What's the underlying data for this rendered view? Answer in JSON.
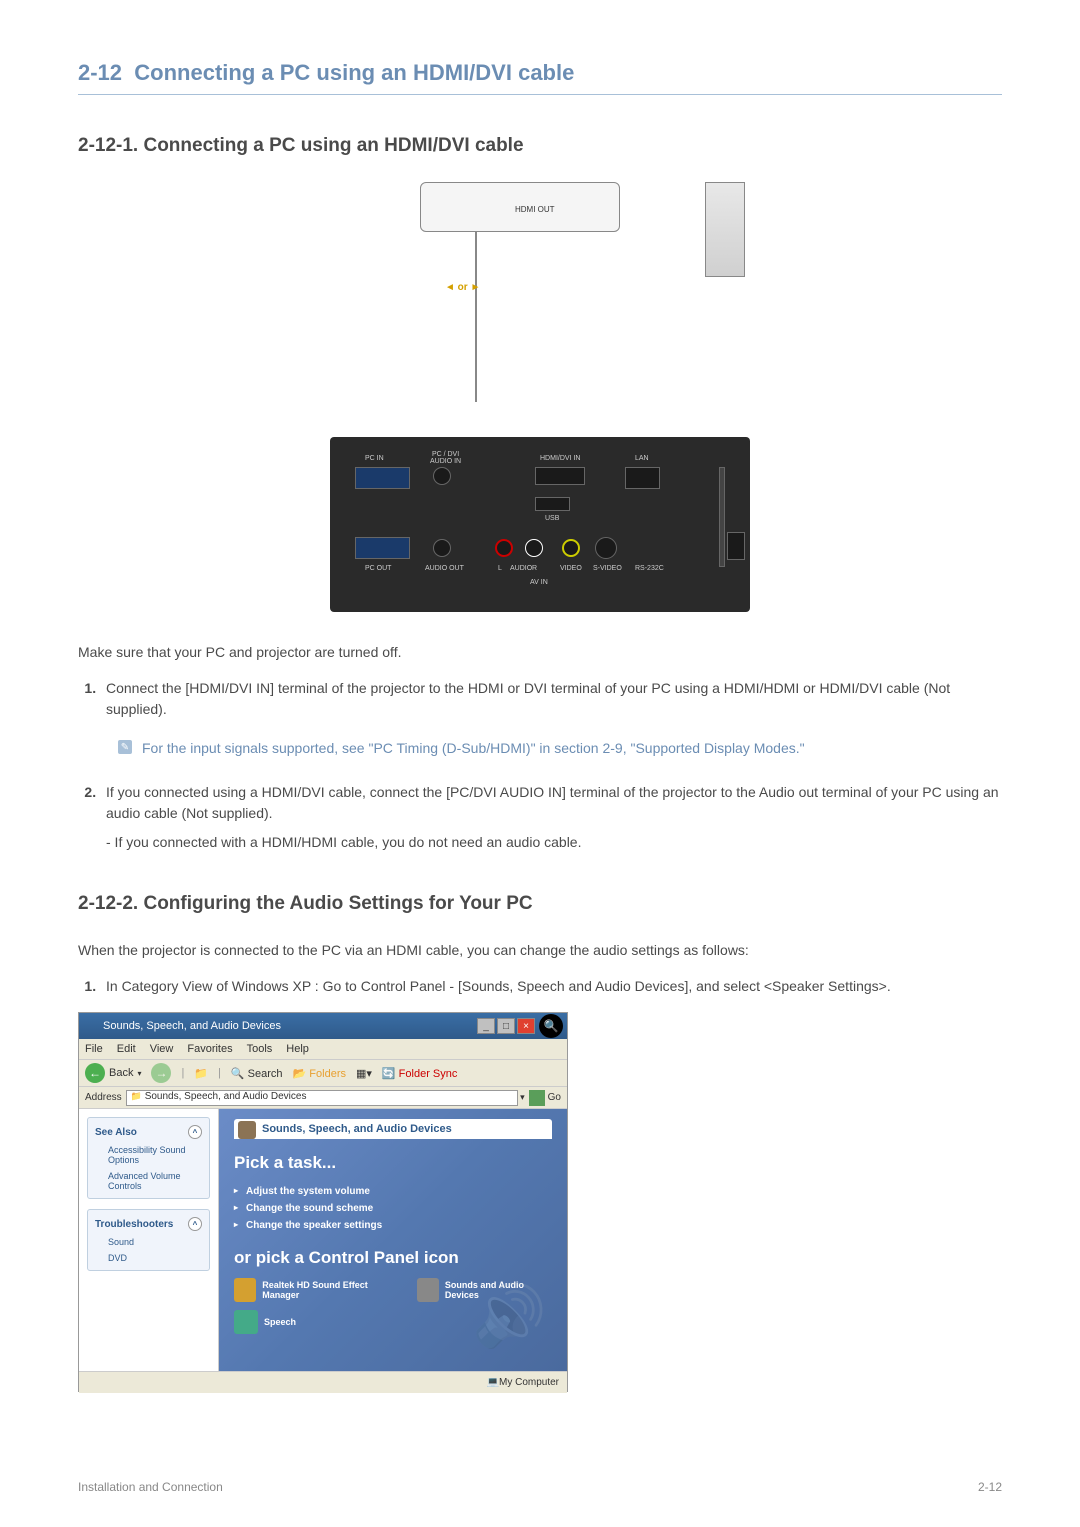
{
  "section": {
    "number": "2-12",
    "title": "Connecting a PC using an HDMI/DVI cable"
  },
  "subsection1": {
    "number": "2-12-1.",
    "title": "Connecting a PC using an HDMI/DVI cable"
  },
  "diagram": {
    "hdmi_out": "HDMI OUT",
    "or": "◄ or ►",
    "ports": {
      "pc_in": "PC IN",
      "pc_dvi_audio_in": "PC / DVI\nAUDIO IN",
      "hdmi_dvi_in": "HDMI/DVI IN",
      "lan": "LAN",
      "pc_out": "PC OUT",
      "audio_out": "AUDIO OUT",
      "audio": "AUDIO",
      "video": "VIDEO",
      "s_video": "S-VIDEO",
      "rs_232c": "RS-232C",
      "usb": "USB",
      "av_in": "AV IN",
      "l": "L",
      "r": "R"
    }
  },
  "intro_text": "Make sure that your PC and projector are turned off.",
  "step1": "Connect the [HDMI/DVI IN] terminal of the projector to the HDMI or DVI terminal of your PC using a HDMI/HDMI or HDMI/DVI cable (Not supplied).",
  "note1": "For the input signals supported, see \"PC Timing (D-Sub/HDMI)\" in section 2-9, \"Supported Display Modes.\"",
  "step2": "If you connected using a HDMI/DVI cable, connect the [PC/DVI AUDIO IN] terminal of the projector to the Audio out terminal of your PC using an audio cable (Not supplied).",
  "step2_sub": "- If you connected with a HDMI/HDMI cable, you do not need an audio cable.",
  "subsection2": {
    "number": "2-12-2.",
    "title": "Configuring the Audio Settings for Your PC"
  },
  "section2_intro": "When the projector is connected to the PC via an HDMI cable, you can change the audio settings as follows:",
  "section2_step1": "In Category View of Windows XP : Go to Control Panel - [Sounds, Speech and Audio Devices], and select <Speaker Settings>.",
  "screenshot": {
    "window_title": "Sounds, Speech, and Audio Devices",
    "menu": {
      "file": "File",
      "edit": "Edit",
      "view": "View",
      "favorites": "Favorites",
      "tools": "Tools",
      "help": "Help"
    },
    "toolbar": {
      "back": "Back",
      "search": "Search",
      "folders": "Folders",
      "folder_sync": "Folder Sync"
    },
    "address_label": "Address",
    "address_value": "Sounds, Speech, and Audio Devices",
    "go": "Go",
    "sidebar": {
      "see_also": "See Also",
      "accessibility": "Accessibility Sound Options",
      "advanced_volume": "Advanced Volume Controls",
      "troubleshooters": "Troubleshooters",
      "sound": "Sound",
      "dvd": "DVD"
    },
    "panel_header": "Sounds, Speech, and Audio Devices",
    "pick_task": "Pick a task...",
    "tasks": {
      "adjust_volume": "Adjust the system volume",
      "change_scheme": "Change the sound scheme",
      "change_speaker": "Change the speaker settings"
    },
    "or_pick": "or pick a Control Panel icon",
    "icons": {
      "realtek": "Realtek HD Sound Effect Manager",
      "sounds_audio": "Sounds and Audio Devices",
      "speech": "Speech"
    },
    "statusbar": "My Computer"
  },
  "footer": {
    "left": "Installation and Connection",
    "right": "2-12"
  }
}
